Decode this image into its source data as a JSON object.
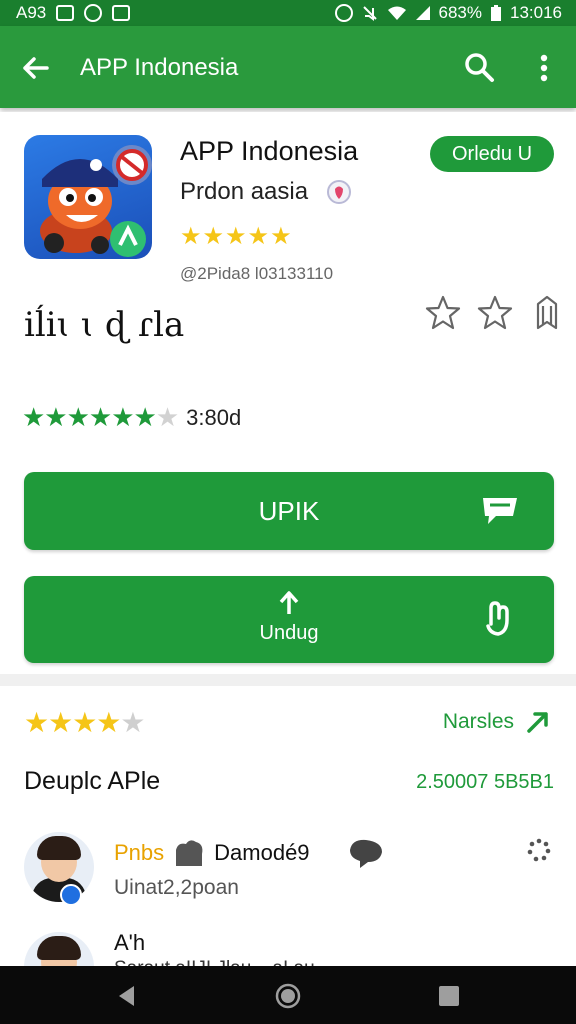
{
  "status_bar": {
    "left_text": "A93",
    "battery": "683%",
    "time": "13:016"
  },
  "app_bar": {
    "title": "APP Indonesia",
    "back_icon": "arrow-back-icon",
    "search_icon": "search-icon",
    "more_icon": "more-vert-icon"
  },
  "app": {
    "name": "APP Indonesia",
    "open_label": "Orledu U",
    "developer": "Prdon aasia",
    "rating_stars": 4.5,
    "meta": "@2Pida8 l03133110",
    "tagline": "iĺiɩ ɩ  ɖ  ɾla",
    "colors": {
      "brand_green": "#1f9a3a",
      "appbar_green": "#2a9a3d",
      "star_yellow": "#f5c518"
    }
  },
  "rating": {
    "stars_filled": 6,
    "stars_total": 7,
    "count": "3:80d"
  },
  "buttons": {
    "primary_label": "UPIK",
    "secondary_label": "Undug"
  },
  "reviews": {
    "stars_filled": 4.5,
    "link_label": "Narsles",
    "section_title": "Deuplc APle",
    "section_count": "2.50007 5B5B1",
    "items": [
      {
        "prefix": "Pnbs",
        "name": "Damodé9",
        "meta": "Uinat2,2poan"
      },
      {
        "name": "A'h",
        "text": "Saraut aIIJI Jlau... aI au ..."
      }
    ]
  },
  "nav_bar": {
    "back": "nav-back-icon",
    "home": "nav-home-icon",
    "recents": "nav-recents-icon"
  }
}
